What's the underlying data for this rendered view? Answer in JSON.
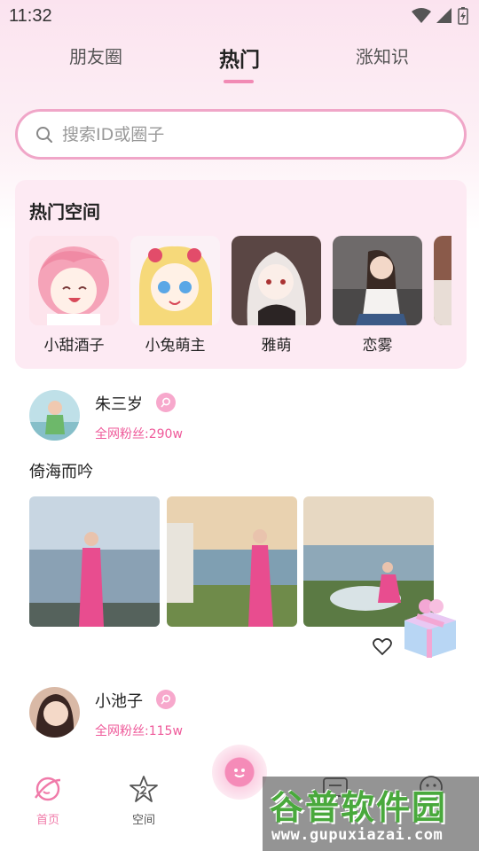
{
  "status_bar": {
    "time": "11:32"
  },
  "tabs": [
    {
      "label": "朋友圈"
    },
    {
      "label": "热门"
    },
    {
      "label": "涨知识"
    }
  ],
  "search": {
    "placeholder": "搜索ID或圈子"
  },
  "hot_spaces": {
    "title": "热门空间",
    "items": [
      {
        "name": "小甜酒子"
      },
      {
        "name": "小兔萌主"
      },
      {
        "name": "雅萌"
      },
      {
        "name": "恋雾"
      }
    ]
  },
  "posts": [
    {
      "username": "朱三岁",
      "fans": "全网粉丝:290w",
      "text": "倚海而吟"
    },
    {
      "username": "小池子",
      "fans": "全网粉丝:115w"
    }
  ],
  "bottom_nav": {
    "items": [
      {
        "label": "首页",
        "icon": "home-planet-icon"
      },
      {
        "label": "空间",
        "icon": "star-space-icon"
      },
      {
        "label": "",
        "icon": "message-icon"
      },
      {
        "label": "",
        "icon": "profile-icon"
      }
    ]
  },
  "watermark": {
    "title": "谷普软件园",
    "url": "www.gupuxiazai.com"
  },
  "colors": {
    "accent": "#f18ab4",
    "fans": "#ef5a9a",
    "card_bg": "#fdeaf3"
  }
}
